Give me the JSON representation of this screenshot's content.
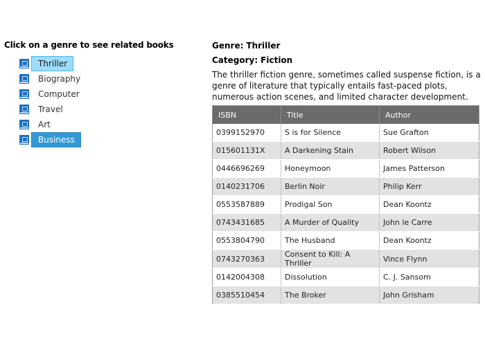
{
  "left_panel": {
    "heading": "Click on a genre to see related books",
    "genres": [
      {
        "label": "Thriller",
        "state": "hover"
      },
      {
        "label": "Biography",
        "state": "normal"
      },
      {
        "label": "Computer",
        "state": "normal"
      },
      {
        "label": "Travel",
        "state": "normal"
      },
      {
        "label": "Art",
        "state": "normal"
      },
      {
        "label": "Business",
        "state": "selected"
      }
    ],
    "icon": "book-icon"
  },
  "detail": {
    "genre_label": "Genre:",
    "genre_value": "Thriller",
    "category_label": "Category:",
    "category_value": "Fiction",
    "description": "The thriller fiction genre, sometimes called suspense fiction, is a genre of literature that typically entails fast-paced plots, numerous action scenes, and limited character development."
  },
  "table": {
    "columns": [
      "ISBN",
      "Title",
      "Author"
    ],
    "rows": [
      [
        "0399152970",
        "S is for Silence",
        "Sue Grafton"
      ],
      [
        "015601131X",
        "A Darkening Stain",
        "Robert Wilson"
      ],
      [
        "0446696269",
        "Honeymoon",
        "James Patterson"
      ],
      [
        "0140231706",
        "Berlin Noir",
        "Philip Kerr"
      ],
      [
        "0553587889",
        "Prodigal Son",
        "Dean Koontz"
      ],
      [
        "0743431685",
        "A Murder of Quality",
        "John le Carre"
      ],
      [
        "0553804790",
        "The Husband",
        "Dean Koontz"
      ],
      [
        "0743270363",
        "Consent to Kill: A Thriller",
        "Vince Flynn"
      ],
      [
        "0142004308",
        "Dissolution",
        "C. J. Sansom"
      ],
      [
        "0385510454",
        "The Broker",
        "John Grisham"
      ]
    ]
  },
  "colors": {
    "selected_bg": "#3399d6",
    "hover_bg": "#9edcfb",
    "header_bg": "#6b6b6b",
    "alt_row_bg": "#e2e2e2"
  }
}
